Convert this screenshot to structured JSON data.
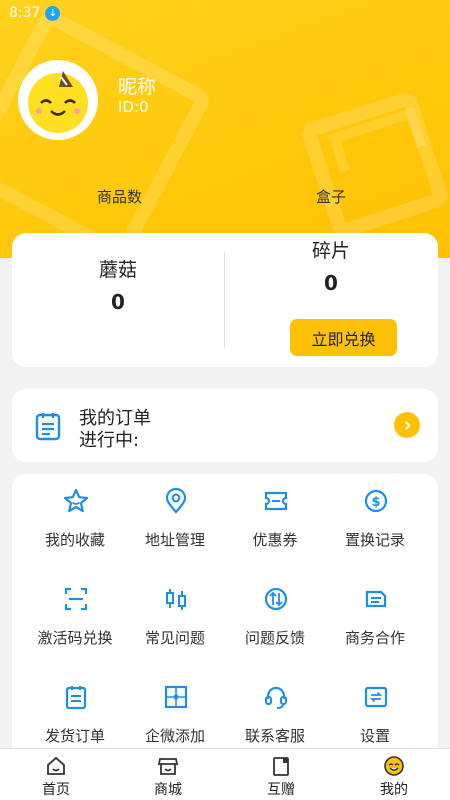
{
  "status": {
    "time": "8:37"
  },
  "profile": {
    "nickname": "昵称",
    "id": "ID:0"
  },
  "stats": {
    "goods_label": "商品数",
    "box_label": "盒子"
  },
  "points": {
    "mushroom": {
      "label": "蘑菇",
      "value": "0"
    },
    "fragment": {
      "label": "碎片",
      "value": "0"
    },
    "redeem_label": "立即兑换"
  },
  "orders": {
    "title": "我的订单",
    "status": "进行中:"
  },
  "menu": [
    {
      "label": "我的收藏",
      "icon": "star-icon"
    },
    {
      "label": "地址管理",
      "icon": "location-pin-icon"
    },
    {
      "label": "优惠券",
      "icon": "coupon-icon"
    },
    {
      "label": "置换记录",
      "icon": "exchange-record-icon"
    },
    {
      "label": "激活码兑换",
      "icon": "scan-code-icon"
    },
    {
      "label": "常见问题",
      "icon": "faq-icon"
    },
    {
      "label": "问题反馈",
      "icon": "feedback-icon"
    },
    {
      "label": "商务合作",
      "icon": "business-icon"
    },
    {
      "label": "发货订单",
      "icon": "shipping-order-icon"
    },
    {
      "label": "企微添加",
      "icon": "wecom-add-icon"
    },
    {
      "label": "联系客服",
      "icon": "headset-icon"
    },
    {
      "label": "设置",
      "icon": "settings-icon"
    }
  ],
  "tabs": [
    {
      "label": "首页",
      "icon": "home-icon"
    },
    {
      "label": "商城",
      "icon": "shop-icon"
    },
    {
      "label": "互赠",
      "icon": "gift-exchange-icon"
    },
    {
      "label": "我的",
      "icon": "profile-icon"
    }
  ],
  "colors": {
    "brand_yellow": "#ffc107",
    "icon_blue": "#1e8fe8",
    "background": "#f2f2f2"
  }
}
